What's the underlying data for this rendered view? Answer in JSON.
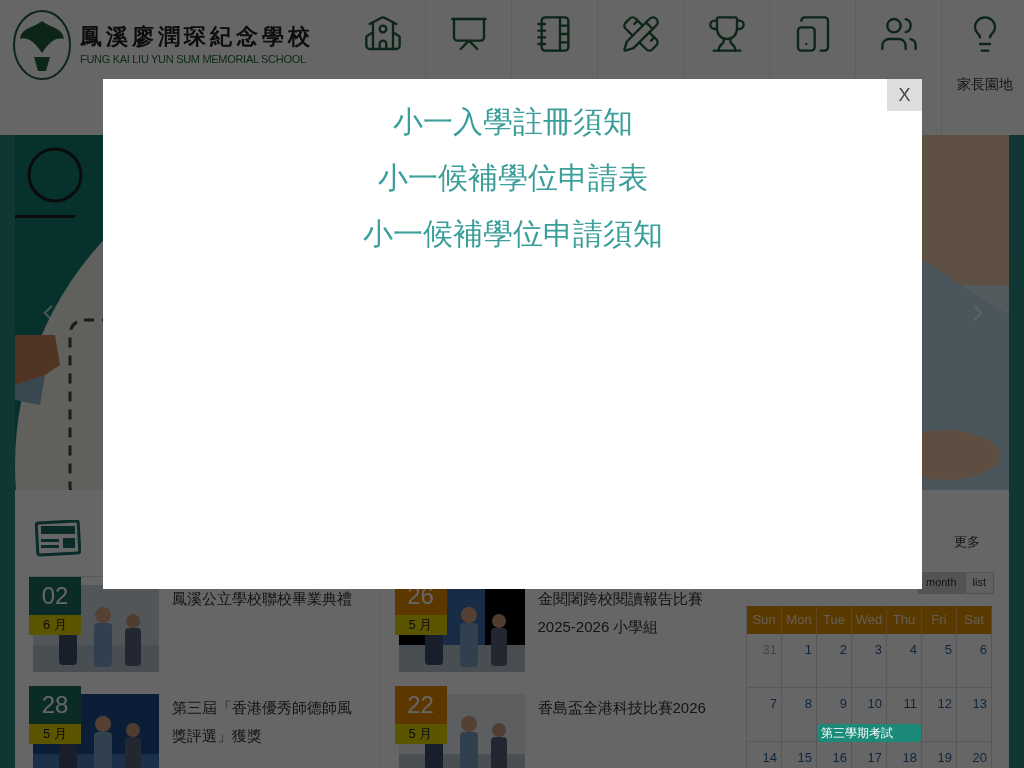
{
  "header": {
    "school_name_zh": "鳳溪廖潤琛紀念學校",
    "school_name_en": "FUNG KAI LIU YUN SUM MEMORIAL SCHOOL",
    "nav_visible_label": "家長園地"
  },
  "news": {
    "items": [
      {
        "day": "02",
        "month": "6 月",
        "title": "鳳溪公立學校聯校畢業典禮",
        "color": "#0b2b27"
      },
      {
        "day": "26",
        "month": "5 月",
        "title": "金閱闍跨校閱讀報告比賽2025-2026 小學組",
        "color": "#5c3700"
      },
      {
        "day": "28",
        "month": "5 月",
        "title": "第三屆「香港優秀師德師風獎評選」獲獎",
        "color": "#0b2b27"
      },
      {
        "day": "22",
        "month": "5 月",
        "title": "香島盃全港科技比賽2026",
        "color": "#5c3700"
      }
    ]
  },
  "calendar": {
    "more": "更多",
    "views": [
      {
        "label": "month",
        "selected": true
      },
      {
        "label": "list",
        "selected": false
      }
    ],
    "weekdays": [
      "Sun",
      "Mon",
      "Tue",
      "Wed",
      "Thu",
      "Fri",
      "Sat"
    ],
    "weeks": [
      {
        "days": [
          {
            "label": "31",
            "other_month": true
          },
          {
            "label": "1",
            "other_month": false
          },
          {
            "label": "2",
            "other_month": false
          },
          {
            "label": "3",
            "other_month": false
          },
          {
            "label": "4",
            "other_month": false
          },
          {
            "label": "5",
            "other_month": false
          },
          {
            "label": "6",
            "other_month": false
          }
        ]
      },
      {
        "days": [
          {
            "label": "7",
            "other_month": false
          },
          {
            "label": "8",
            "other_month": false
          },
          {
            "label": "9",
            "other_month": false,
            "event": "第三學期考試"
          },
          {
            "label": "10",
            "other_month": false
          },
          {
            "label": "11",
            "other_month": false
          },
          {
            "label": "12",
            "other_month": false
          },
          {
            "label": "13",
            "other_month": false
          }
        ]
      },
      {
        "days": [
          {
            "label": "14",
            "other_month": false
          },
          {
            "label": "15",
            "other_month": false
          },
          {
            "label": "16",
            "other_month": false
          },
          {
            "label": "17",
            "other_month": false
          },
          {
            "label": "18",
            "other_month": false
          },
          {
            "label": "19",
            "other_month": false
          },
          {
            "label": "20",
            "other_month": false
          }
        ]
      }
    ]
  },
  "modal": {
    "links": [
      "小一入學註冊須知",
      "小一候補學位申請表",
      "小一候補學位申請須知"
    ],
    "close": "X"
  }
}
